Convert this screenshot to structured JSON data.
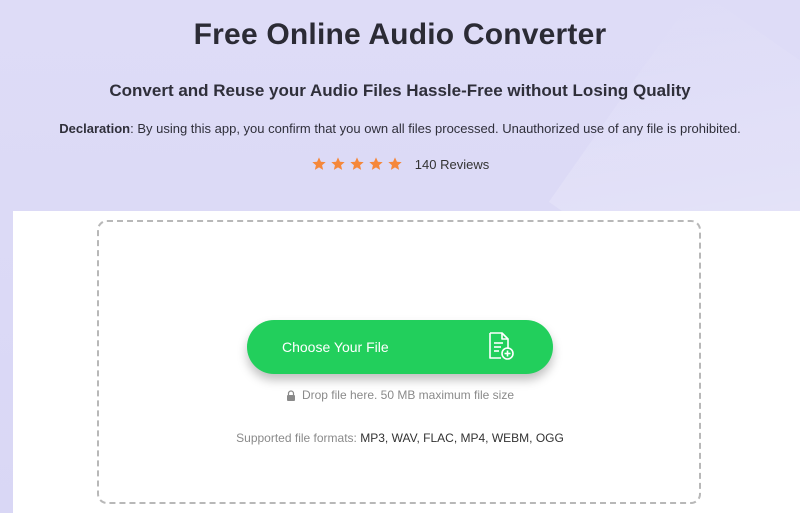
{
  "header": {
    "title": "Free Online Audio Converter",
    "subtitle": "Convert and Reuse your Audio Files Hassle-Free without Losing Quality",
    "declaration_label": "Declaration",
    "declaration_text": ": By using this app, you confirm that you own all files processed. Unauthorized use of any file is prohibited."
  },
  "rating": {
    "stars": 5,
    "reviews": "140 Reviews",
    "star_color": "#f5873a"
  },
  "upload": {
    "button_label": "Choose Your File",
    "button_color": "#22cf5c",
    "button_icon": "file-add-icon",
    "drop_hint": "Drop file here. 50 MB maximum file size",
    "formats_label": "Supported file formats:",
    "formats_list": "MP3, WAV, FLAC, MP4, WEBM, OGG"
  }
}
